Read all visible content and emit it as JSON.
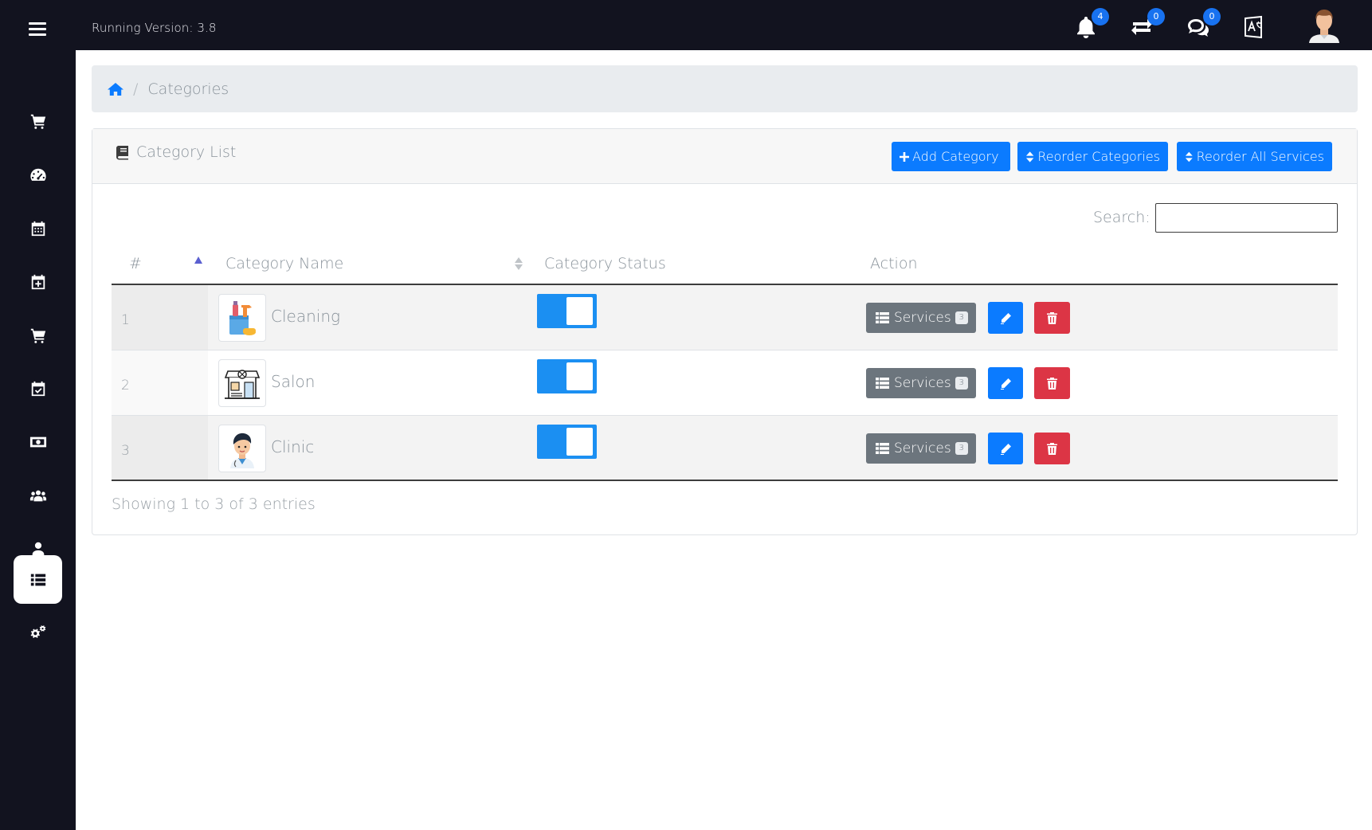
{
  "topbar": {
    "version_text": "Running Version: 3.8",
    "icons": [
      {
        "name": "bell-icon",
        "badge": "4"
      },
      {
        "name": "exchange-icon",
        "badge": "0"
      },
      {
        "name": "chat-icon",
        "badge": "0"
      },
      {
        "name": "translate-icon"
      }
    ]
  },
  "sidebar": {
    "items": [
      {
        "name": "cart-icon",
        "active": false
      },
      {
        "name": "dashboard-icon",
        "active": false
      },
      {
        "name": "calendar-icon",
        "active": false
      },
      {
        "name": "calendar-plus-icon",
        "active": false
      },
      {
        "name": "cart-icon",
        "active": false
      },
      {
        "name": "calendar-check-icon",
        "active": false
      },
      {
        "name": "money-icon",
        "active": false
      },
      {
        "name": "users-icon",
        "active": false
      },
      {
        "name": "user-icon",
        "active": false
      },
      {
        "name": "list-icon",
        "active": true
      },
      {
        "name": "gears-icon",
        "active": false
      }
    ]
  },
  "breadcrumb": {
    "current": "Categories"
  },
  "card": {
    "title": "Category List",
    "buttons": {
      "add": "Add Category",
      "reorder_categories": "Reorder Categories",
      "reorder_services": "Reorder All Services"
    }
  },
  "search": {
    "label": "Search:",
    "value": ""
  },
  "table": {
    "columns": [
      "#",
      "Category Name",
      "Category Status",
      "Action"
    ],
    "rows": [
      {
        "index": "1",
        "name": "Cleaning",
        "status_on": true,
        "services_label": "Services",
        "services_count": "3"
      },
      {
        "index": "2",
        "name": "Salon",
        "status_on": true,
        "services_label": "Services",
        "services_count": "3"
      },
      {
        "index": "3",
        "name": "Clinic",
        "status_on": true,
        "services_label": "Services",
        "services_count": "3"
      }
    ],
    "info": "Showing 1 to 3 of 3 entries"
  },
  "colors": {
    "dark": "#12131f",
    "primary": "#0b7bff",
    "danger": "#dc3545",
    "secondary": "#6c757d",
    "toggle_on": "#1b8ff2"
  }
}
